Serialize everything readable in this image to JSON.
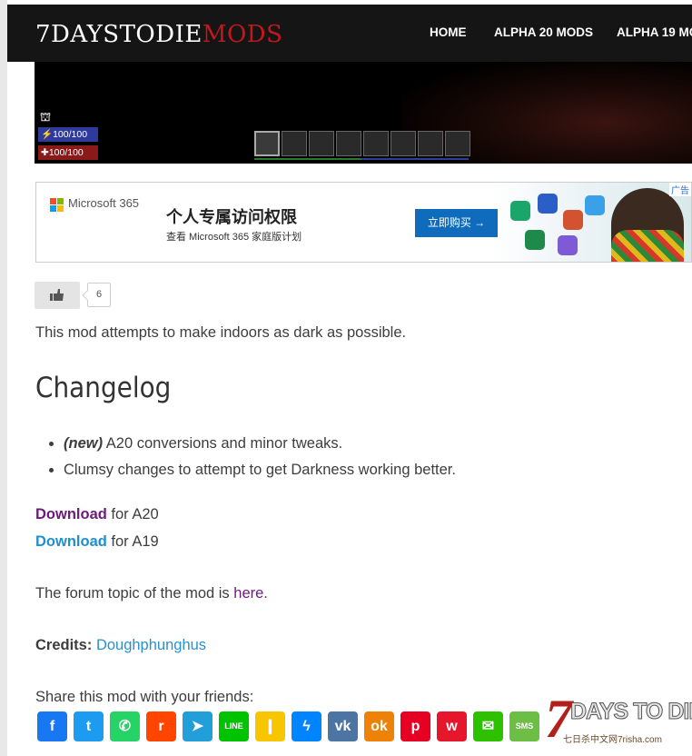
{
  "header": {
    "logo_part1": "7DAYSTODIE",
    "logo_part2": "MODS",
    "nav": [
      "HOME",
      "ALPHA 20 MODS",
      "ALPHA 19 MO"
    ]
  },
  "game": {
    "stamina": "100/100",
    "health": "100/100"
  },
  "ad": {
    "brand": "Microsoft 365",
    "title": "个人专属访问权限",
    "subtitle": "查看 Microsoft 365 家庭版计划",
    "button": "立即购买 →",
    "tag": "广告",
    "colors": {
      "button": "#0f6cbd"
    }
  },
  "like": {
    "icon": "thumbs-up-icon",
    "count": "6"
  },
  "intro": "This mod attempts to make indoors as dark as possible.",
  "changelog": {
    "heading": "Changelog",
    "items": [
      {
        "prefix": "(new)",
        "text": " A20 conversions and minor tweaks."
      },
      {
        "prefix": "",
        "text": "Clumsy changes to attempt to get Darkness working better."
      }
    ]
  },
  "downloads": [
    {
      "link": "Download",
      "suffix": " for A20"
    },
    {
      "link": "Download",
      "suffix": " for A19"
    }
  ],
  "forum": {
    "text": "The forum topic of the mod is ",
    "link": "here",
    "end": "."
  },
  "credits": {
    "label": "Credits:",
    "name": "Doughphunghus"
  },
  "share": {
    "label": "Share this mod with your friends:",
    "buttons": [
      {
        "name": "facebook",
        "glyph": "f",
        "color": "#1877f2"
      },
      {
        "name": "twitter",
        "glyph": "t",
        "color": "#1d9bf0"
      },
      {
        "name": "whatsapp",
        "glyph": "✆",
        "color": "#25d366"
      },
      {
        "name": "reddit",
        "glyph": "r",
        "color": "#ff4500"
      },
      {
        "name": "telegram",
        "glyph": "➤",
        "color": "#229ed9"
      },
      {
        "name": "line",
        "glyph": "LINE",
        "color": "#00c300"
      },
      {
        "name": "kakao",
        "glyph": "❙",
        "color": "#f7c600"
      },
      {
        "name": "messenger",
        "glyph": "ϟ",
        "color": "#0084ff"
      },
      {
        "name": "vk",
        "glyph": "vk",
        "color": "#4c75a3"
      },
      {
        "name": "odnoklassniki",
        "glyph": "ok",
        "color": "#ee8208"
      },
      {
        "name": "pinterest",
        "glyph": "p",
        "color": "#e60023"
      },
      {
        "name": "weibo",
        "glyph": "w",
        "color": "#e6162d"
      },
      {
        "name": "wechat",
        "glyph": "✉",
        "color": "#2dc100"
      },
      {
        "name": "sms",
        "glyph": "SMS",
        "color": "#6cbe45"
      }
    ]
  },
  "watermark": {
    "seven": "7",
    "text": "DAYS TO DIE",
    "sub": "七日杀中文网7risha.com"
  }
}
